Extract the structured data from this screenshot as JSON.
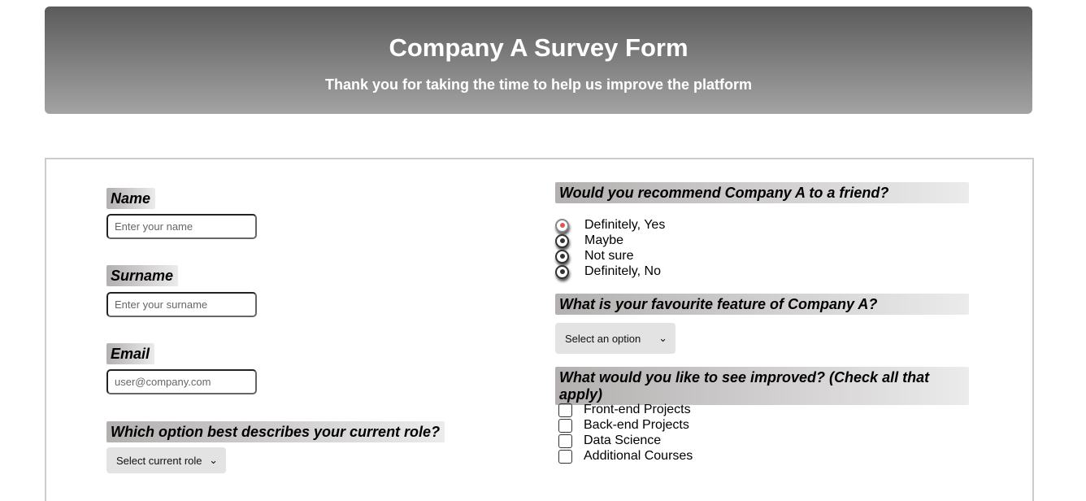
{
  "header": {
    "title": "Company A Survey Form",
    "subtitle": "Thank you for taking the time to help us improve the platform"
  },
  "fields": {
    "name": {
      "label": "Name",
      "placeholder": "Enter your name"
    },
    "surname": {
      "label": "Surname",
      "placeholder": "Enter your surname"
    },
    "email": {
      "label": "Email",
      "placeholder": "user@company.com"
    },
    "role": {
      "label": "Which option best describes your current role?",
      "selected": "Select current role"
    }
  },
  "recommend": {
    "label": "Would you recommend Company A to a friend?",
    "options": [
      "Definitely, Yes",
      "Maybe",
      "Not sure",
      "Definitely, No"
    ],
    "selected": "Definitely, Yes"
  },
  "feature": {
    "label": "What is your favourite feature of Company A?",
    "selected": "Select an option"
  },
  "improve": {
    "label": "What would you like to see improved? (Check all that apply)",
    "options": [
      "Front-end Projects",
      "Back-end Projects",
      "Data Science",
      "Additional Courses"
    ]
  },
  "colors": {
    "header_top": "#5c5b5b",
    "header_bottom": "#a3a3a3",
    "radio_selected": "#e05555"
  }
}
